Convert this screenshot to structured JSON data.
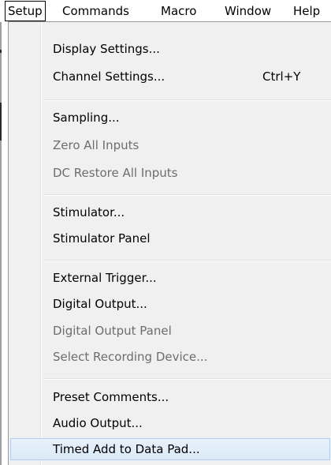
{
  "menubar": {
    "items": [
      {
        "label": "Setup",
        "active": true
      },
      {
        "label": "Commands"
      },
      {
        "label": "Macro"
      },
      {
        "label": "Window"
      },
      {
        "label": "Help"
      }
    ]
  },
  "menu": {
    "groups": [
      [
        {
          "label": "Display Settings...",
          "enabled": true
        },
        {
          "label": "Channel Settings...",
          "shortcut": "Ctrl+Y",
          "enabled": true
        }
      ],
      [
        {
          "label": "Sampling...",
          "enabled": true
        },
        {
          "label": "Zero All Inputs",
          "enabled": false
        },
        {
          "label": "DC Restore All Inputs",
          "enabled": false
        }
      ],
      [
        {
          "label": "Stimulator...",
          "enabled": true
        },
        {
          "label": "Stimulator Panel",
          "enabled": true
        }
      ],
      [
        {
          "label": "External Trigger...",
          "enabled": true
        },
        {
          "label": "Digital Output...",
          "enabled": true
        },
        {
          "label": "Digital Output Panel",
          "enabled": false
        },
        {
          "label": "Select Recording Device...",
          "enabled": false
        }
      ],
      [
        {
          "label": "Preset Comments...",
          "enabled": true
        },
        {
          "label": "Audio Output...",
          "enabled": true
        },
        {
          "label": "Timed Add to Data Pad...",
          "enabled": true,
          "highlighted": true
        }
      ]
    ]
  },
  "colors": {
    "menu_background": "#f0f0f0",
    "disabled_text": "#6d6d6d",
    "highlight_border": "#aecff7",
    "highlight_fill": "#dbe9f8"
  }
}
